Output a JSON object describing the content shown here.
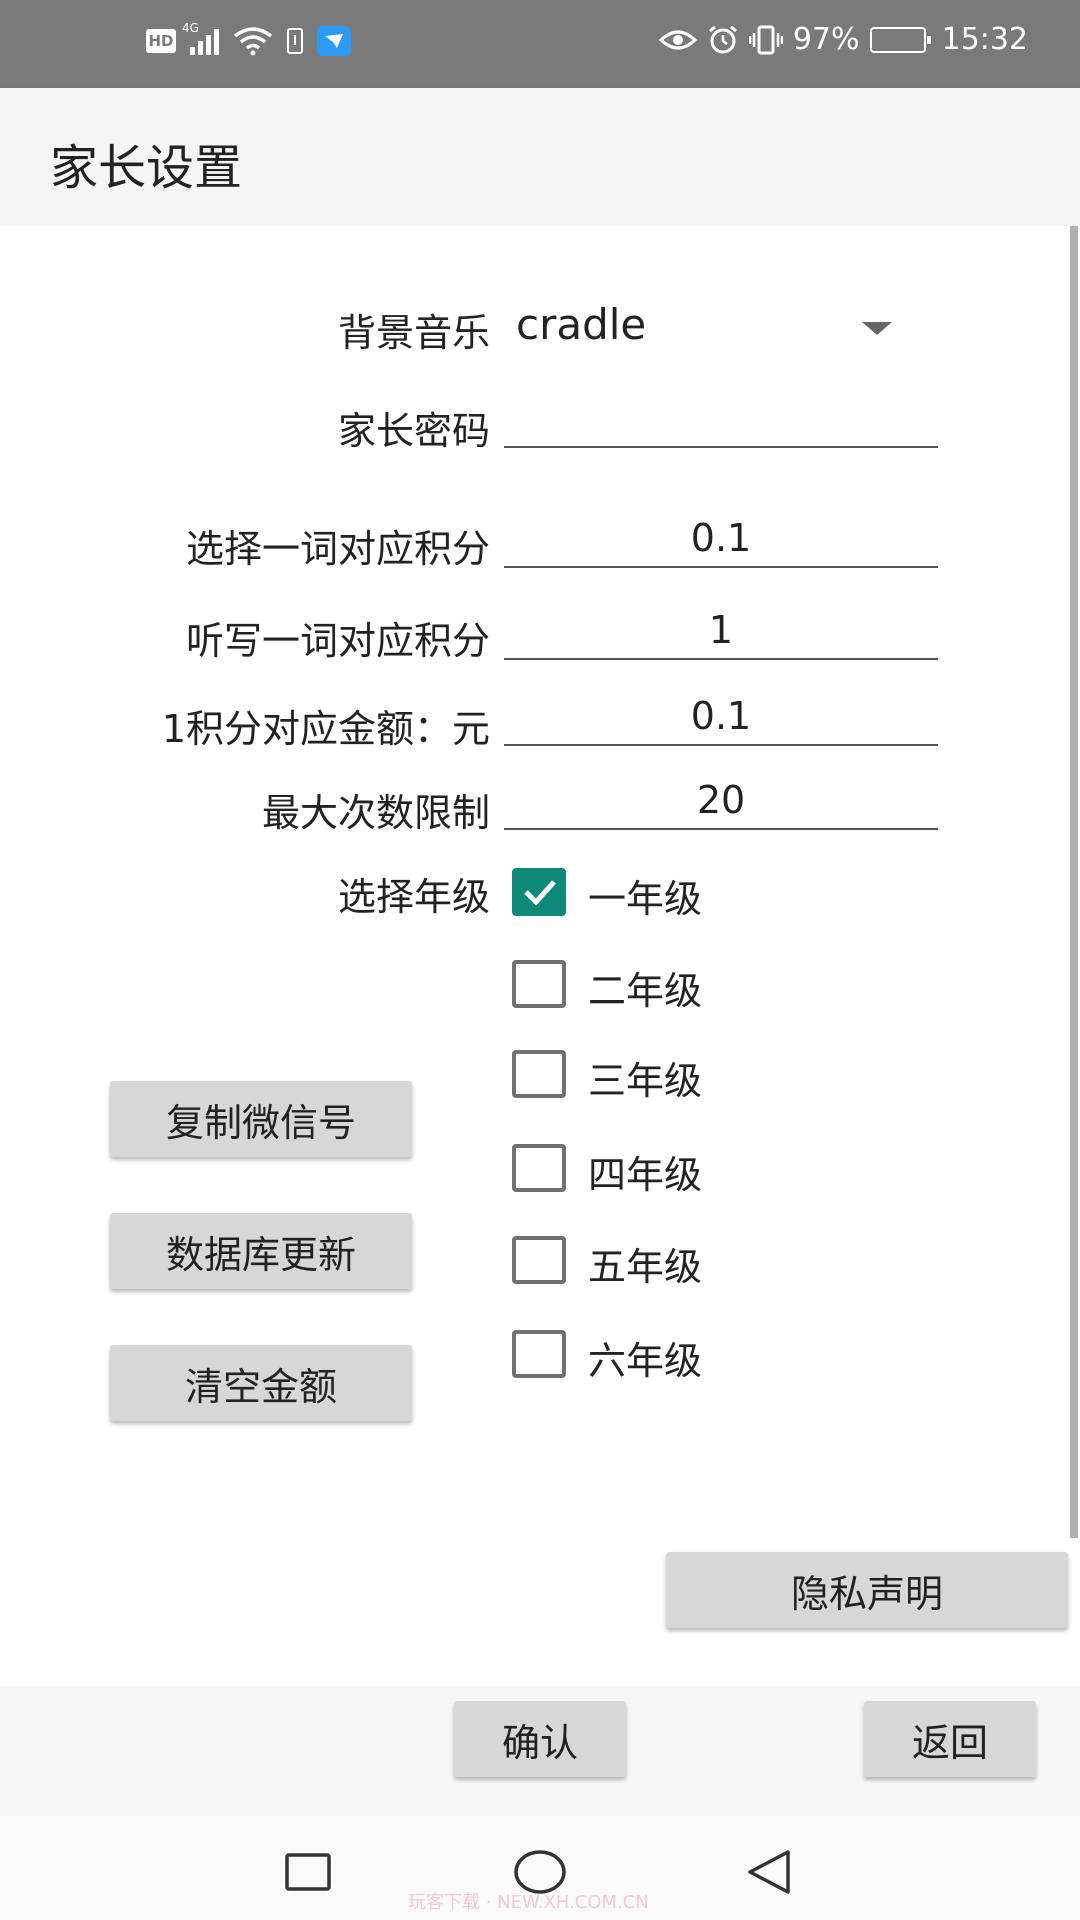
{
  "status_bar": {
    "left_icons": [
      "hd-icon",
      "signal-4g-icon",
      "wifi-icon",
      "battery-alert-icon",
      "app-notification-icon"
    ],
    "network_tag": "4G",
    "hd_label": "HD",
    "battery_percent": "97%",
    "time": "15:32"
  },
  "app_bar": {
    "title": "家长设置"
  },
  "form": {
    "bgm": {
      "label": "背景音乐",
      "value": "cradle"
    },
    "password": {
      "label": "家长密码",
      "value": ""
    },
    "choose_points": {
      "label": "选择一词对应积分",
      "value": "0.1"
    },
    "dictation_points": {
      "label": "听写一词对应积分",
      "value": "1"
    },
    "point_money": {
      "label": "1积分对应金额：元",
      "value": "0.1"
    },
    "max_times": {
      "label": "最大次数限制",
      "value": "20"
    },
    "grade": {
      "label": "选择年级",
      "options": [
        {
          "label": "一年级",
          "checked": true
        },
        {
          "label": "二年级",
          "checked": false
        },
        {
          "label": "三年级",
          "checked": false
        },
        {
          "label": "四年级",
          "checked": false
        },
        {
          "label": "五年级",
          "checked": false
        },
        {
          "label": "六年级",
          "checked": false
        }
      ]
    }
  },
  "buttons": {
    "copy_wechat": "复制微信号",
    "db_update": "数据库更新",
    "clear_amount": "清空金额",
    "privacy": "隐私声明",
    "confirm": "确认",
    "back": "返回"
  },
  "colors": {
    "accent": "#0e8a78",
    "status_bar": "#7a7a7a",
    "button": "#d7d7d7"
  },
  "watermark": "玩客下载 · NEW.XH.COM.CN"
}
